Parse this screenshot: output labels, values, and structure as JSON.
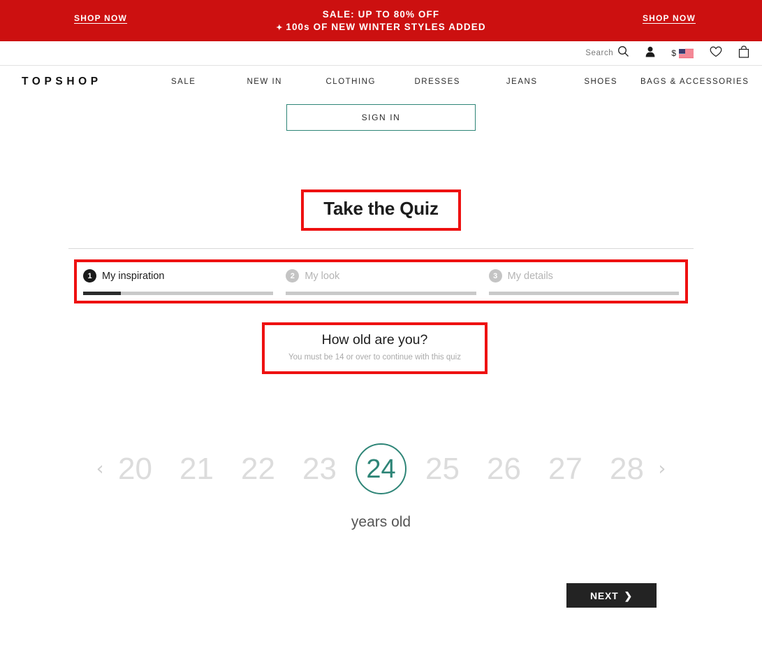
{
  "banner": {
    "shop_now_left": "SHOP NOW",
    "shop_now_right": "SHOP NOW",
    "line1": "SALE: UP TO 80% OFF",
    "line2_bullet": "✦",
    "line2": "100s OF NEW WINTER STYLES ADDED",
    "bg_color": "#CC1010"
  },
  "utility": {
    "search_label": "Search",
    "search_icon": "search-icon",
    "account_icon": "person-icon",
    "currency_symbol": "$",
    "country_flag": "us-flag-icon",
    "wishlist_icon": "heart-icon",
    "bag_icon": "shopping-bag-icon"
  },
  "nav": {
    "brand": "TOPSHOP",
    "links": [
      {
        "label": "SALE"
      },
      {
        "label": "NEW IN"
      },
      {
        "label": "CLOTHING"
      },
      {
        "label": "DRESSES"
      },
      {
        "label": "JEANS"
      },
      {
        "label": "SHOES"
      },
      {
        "label": "BAGS & ACCESSORIES"
      }
    ]
  },
  "account": {
    "sign_in_label": "SIGN IN",
    "border_color": "#2E8577"
  },
  "quiz": {
    "title": "Take the Quiz",
    "steps": [
      {
        "number": "1",
        "label": "My inspiration",
        "state": "active",
        "progress_percent": 20
      },
      {
        "number": "2",
        "label": "My look",
        "state": "inactive",
        "progress_percent": 0
      },
      {
        "number": "3",
        "label": "My details",
        "state": "inactive",
        "progress_percent": 0
      }
    ],
    "question": {
      "title": "How old are you?",
      "subtitle": "You must be 14 or over to continue with this quiz"
    },
    "age_picker": {
      "prev_arrow": "‹",
      "next_arrow": "›",
      "ages": [
        "20",
        "21",
        "22",
        "23",
        "24",
        "25",
        "26",
        "27",
        "28"
      ],
      "selected_age": "24",
      "unit_label": "years old",
      "selected_color": "#2E8577"
    },
    "next_button": {
      "label": "NEXT",
      "chevron": "❯"
    },
    "highlight_color": "#EE1111"
  }
}
